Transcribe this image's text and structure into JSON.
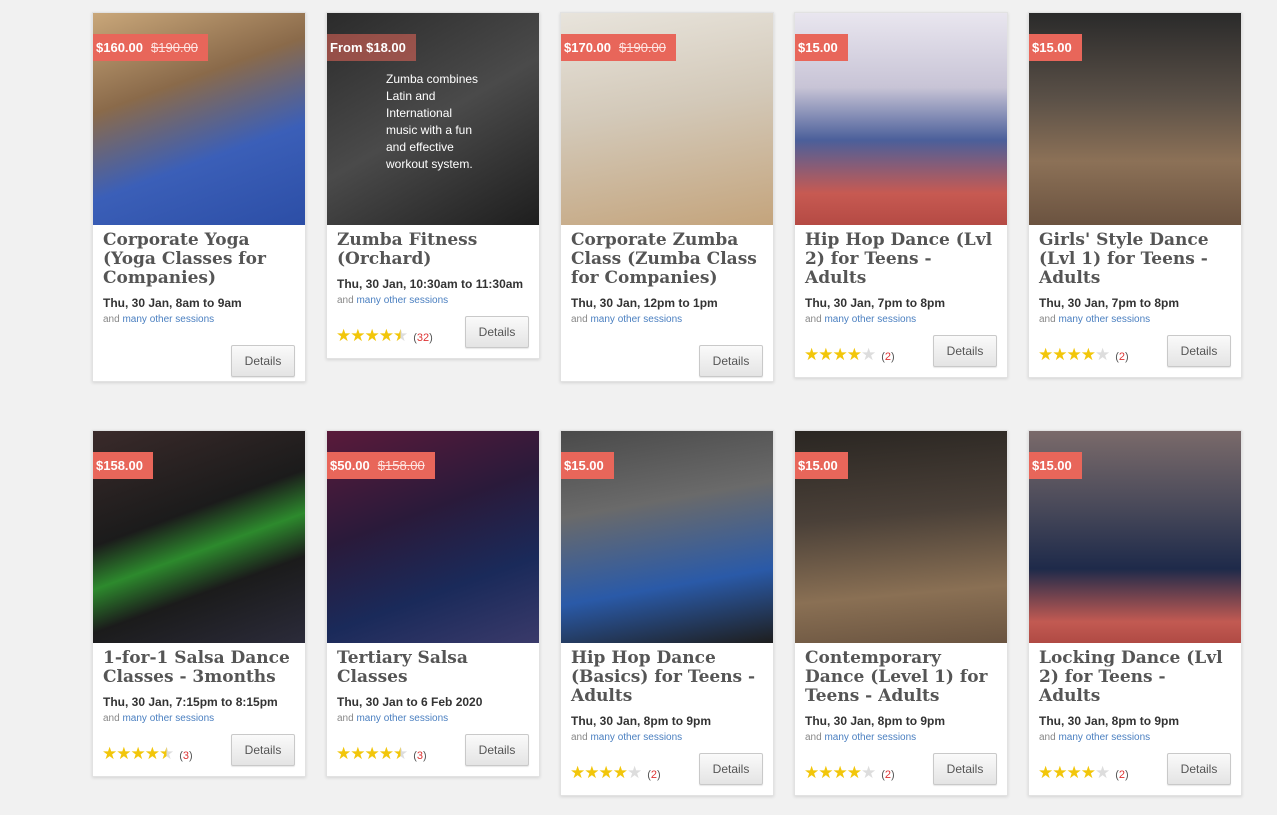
{
  "other_prefix": "and",
  "other_link": "many other sessions",
  "details_label": "Details",
  "cards": [
    {
      "price": "$160.00",
      "old_price": "$190.00",
      "title": "Corporate Yoga (Yoga Classes for Companies)",
      "when": "Thu, 30 Jan, 8am to 9am",
      "rating": null,
      "reviews": null
    },
    {
      "price": "From $18.00",
      "old_price": "",
      "description": "Zumba combines Latin and International music with a fun and effective workout system.",
      "title": "Zumba Fitness (Orchard)",
      "when": "Thu, 30 Jan, 10:30am to 11:30am",
      "rating": 4.5,
      "reviews": "32"
    },
    {
      "price": "$170.00",
      "old_price": "$190.00",
      "title": "Corporate Zumba Class (Zumba Class for Companies)",
      "when": "Thu, 30 Jan, 12pm to 1pm",
      "rating": null,
      "reviews": null
    },
    {
      "price": "$15.00",
      "old_price": "",
      "title": "Hip Hop Dance (Lvl 2) for Teens - Adults",
      "when": "Thu, 30 Jan, 7pm to 8pm",
      "rating": 4,
      "reviews": "2"
    },
    {
      "price": "$15.00",
      "old_price": "",
      "title": "Girls' Style Dance (Lvl 1) for Teens - Adults",
      "when": "Thu, 30 Jan, 7pm to 8pm",
      "rating": 4,
      "reviews": "2"
    },
    {
      "price": "$158.00",
      "old_price": "",
      "title": "1-for-1 Salsa Dance Classes - 3months",
      "when": "Thu, 30 Jan, 7:15pm to 8:15pm",
      "rating": 4.5,
      "reviews": "3"
    },
    {
      "price": "$50.00",
      "old_price": "$158.00",
      "title": "Tertiary Salsa Classes",
      "when": "Thu, 30 Jan to 6 Feb 2020",
      "rating": 4.5,
      "reviews": "3"
    },
    {
      "price": "$15.00",
      "old_price": "",
      "title": "Hip Hop Dance (Basics) for Teens - Adults",
      "when": "Thu, 30 Jan, 8pm to 9pm",
      "rating": 4,
      "reviews": "2"
    },
    {
      "price": "$15.00",
      "old_price": "",
      "title": "Contemporary Dance (Level 1) for Teens - Adults",
      "when": "Thu, 30 Jan, 8pm to 9pm",
      "rating": 4,
      "reviews": "2"
    },
    {
      "price": "$15.00",
      "old_price": "",
      "title": "Locking Dance (Lvl 2) for Teens - Adults",
      "when": "Thu, 30 Jan, 8pm to 9pm",
      "rating": 4,
      "reviews": "2"
    }
  ],
  "colors": {
    "price_tag": "#e8665a",
    "star": "#f2c60a",
    "link": "#4a7fc0"
  }
}
